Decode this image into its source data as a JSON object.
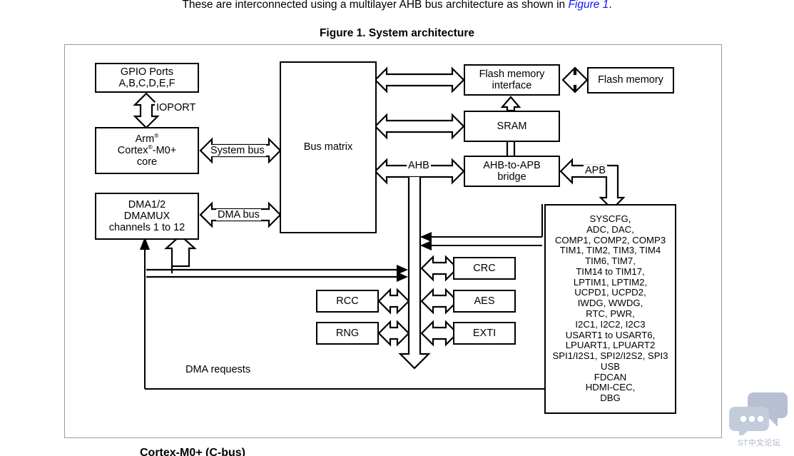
{
  "intro": {
    "text_before": "These are interconnected using a multilayer AHB bus architecture as shown in ",
    "link_text": "Figure 1",
    "text_after": ".",
    "link_color": "#1414ff"
  },
  "figure": {
    "caption": "Figure 1. System architecture"
  },
  "blocks": {
    "gpio": "GPIO Ports\nA,B,C,D,E,F",
    "core": "core",
    "core_line1_a": "Arm",
    "core_line2_a": "Cortex",
    "core_line2_b": "-M0+",
    "dma": "DMA1/2\nDMAMUX\nchannels 1 to 12",
    "bus_matrix": "Bus matrix",
    "flash_interface": "Flash memory\ninterface",
    "flash_memory": "Flash memory",
    "sram": "SRAM",
    "bridge": "AHB-to-APB\nbridge",
    "crc": "CRC",
    "aes": "AES",
    "exti": "EXTI",
    "rcc": "RCC",
    "rng": "RNG",
    "peripherals": "SYSCFG,\nADC, DAC,\nCOMP1, COMP2, COMP3\nTIM1, TIM2, TIM3, TIM4\nTIM6, TIM7,\nTIM14 to TIM17,\nLPTIM1, LPTIM2,\nUCPD1, UCPD2,\nIWDG, WWDG,\nRTC, PWR,\nI2C1, I2C2, I2C3\nUSART1 to USART6,\nLPUART1, LPUART2\nSPI1/I2S1, SPI2/I2S2, SPI3\nUSB\nFDCAN\nHDMI-CEC,\nDBG"
  },
  "bus_labels": {
    "ioport": "IOPORT",
    "system_bus": "System bus",
    "dma_bus": "DMA bus",
    "ahb": "AHB",
    "apb": "APB",
    "dma_requests": "DMA requests"
  },
  "watermark": {
    "text": "ST中文论坛",
    "color": "#aab3c4"
  },
  "bottom_clip": {
    "text": "Cortex-M0+ (C-bus)"
  }
}
